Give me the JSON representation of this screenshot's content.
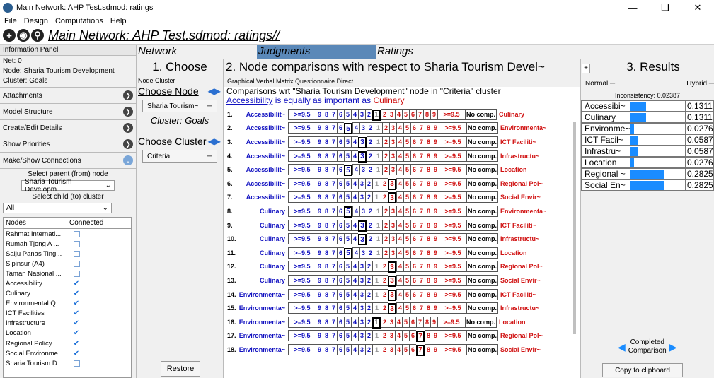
{
  "window": {
    "title": "Main Network: AHP Test.sdmod: ratings"
  },
  "menu": [
    "File",
    "Design",
    "Computations",
    "Help"
  ],
  "path": "Main Network: AHP Test.sdmod: ratings//",
  "info_panel": {
    "header": "Information Panel",
    "net": "Net: 0",
    "node": "Node: Sharia Tourism Development",
    "cluster": "Cluster: Goals",
    "rows": [
      "Attachments",
      "Model Structure",
      "Create/Edit Details",
      "Show Priorities",
      "Make/Show Connections"
    ],
    "select_parent_label": "Select parent (from) node",
    "parent_value": "Sharia Tourism Developm",
    "select_child_label": "Select child (to) cluster",
    "child_value": "All",
    "table_headers": [
      "Nodes",
      "Connected"
    ],
    "nodes": [
      {
        "name": "Rahmat Internati...",
        "connected": false
      },
      {
        "name": "Rumah Tjong A ...",
        "connected": false
      },
      {
        "name": "Salju Panas Ting...",
        "connected": false
      },
      {
        "name": "Sipinsur (A4)",
        "connected": false
      },
      {
        "name": "Taman Nasional ...",
        "connected": false
      },
      {
        "name": "Accessibility",
        "connected": true
      },
      {
        "name": "Culinary",
        "connected": true
      },
      {
        "name": "Environmental Q...",
        "connected": true
      },
      {
        "name": "ICT Facilities",
        "connected": true
      },
      {
        "name": "Infrastructure",
        "connected": true
      },
      {
        "name": "Location",
        "connected": true
      },
      {
        "name": "Regional Policy",
        "connected": true
      },
      {
        "name": "Social Environme...",
        "connected": true
      },
      {
        "name": "Sharia Tourism D...",
        "connected": false
      }
    ]
  },
  "tabs": [
    "Network",
    "Judgments",
    "Ratings"
  ],
  "choose": {
    "title": "1. Choose",
    "subtabs": "Node  Cluster",
    "choose_node": "Choose Node",
    "node_value": "Sharia Tourism~",
    "cluster_label": "Cluster: Goals",
    "choose_cluster": "Choose Cluster",
    "cluster_value": "Criteria",
    "restore": "Restore"
  },
  "comparisons": {
    "title": "2. Node comparisons with respect to Sharia Tourism Devel~",
    "plus": "+",
    "subtabs": "Graphical  Verbal  Matrix  Questionnaire  Direct",
    "wrt": "Comparisons wrt \"Sharia Tourism Development\" node in \"Criteria\" cluster",
    "statement_a": "Accessibility",
    "statement_mid": " is equally as important as ",
    "statement_b": "Culinary",
    "scale_left": [
      "9",
      "8",
      "7",
      "6",
      "5",
      "4",
      "3",
      "2"
    ],
    "scale_right": [
      "2",
      "3",
      "4",
      "5",
      "6",
      "7",
      "8",
      "9"
    ],
    "extreme": ">=9.5",
    "nocomp": "No comp.",
    "rows": [
      {
        "n": "1.",
        "a": "Accessibilit~",
        "b": "Culinary",
        "sel": "1"
      },
      {
        "n": "2.",
        "a": "Accessibilit~",
        "b": "Environmenta~",
        "sel": "L5"
      },
      {
        "n": "3.",
        "a": "Accessibilit~",
        "b": "ICT Faciliti~",
        "sel": "L3"
      },
      {
        "n": "4.",
        "a": "Accessibilit~",
        "b": "Infrastructu~",
        "sel": "L3"
      },
      {
        "n": "5.",
        "a": "Accessibilit~",
        "b": "Location",
        "sel": "L5"
      },
      {
        "n": "6.",
        "a": "Accessibilit~",
        "b": "Regional Pol~",
        "sel": "R3"
      },
      {
        "n": "7.",
        "a": "Accessibilit~",
        "b": "Social Envir~",
        "sel": "R3"
      },
      {
        "n": "8.",
        "a": "Culinary",
        "b": "Environmenta~",
        "sel": "L5"
      },
      {
        "n": "9.",
        "a": "Culinary",
        "b": "ICT Faciliti~",
        "sel": "L3"
      },
      {
        "n": "10.",
        "a": "Culinary",
        "b": "Infrastructu~",
        "sel": "L3"
      },
      {
        "n": "11.",
        "a": "Culinary",
        "b": "Location",
        "sel": "L5"
      },
      {
        "n": "12.",
        "a": "Culinary",
        "b": "Regional Pol~",
        "sel": "R3"
      },
      {
        "n": "13.",
        "a": "Culinary",
        "b": "Social Envir~",
        "sel": "R3"
      },
      {
        "n": "14.",
        "a": "Environmenta~",
        "b": "ICT Faciliti~",
        "sel": "R3"
      },
      {
        "n": "15.",
        "a": "Environmenta~",
        "b": "Infrastructu~",
        "sel": "R3"
      },
      {
        "n": "16.",
        "a": "Environmenta~",
        "b": "Location",
        "sel": "1"
      },
      {
        "n": "17.",
        "a": "Environmenta~",
        "b": "Regional Pol~",
        "sel": "R7"
      },
      {
        "n": "18.",
        "a": "Environmenta~",
        "b": "Social Envir~",
        "sel": "R7"
      }
    ]
  },
  "results": {
    "title": "3. Results",
    "mode_left": "Normal",
    "mode_right": "Hybrid",
    "inconsistency": "Inconsistency: 0.02387",
    "items": [
      {
        "name": "Accessibi~",
        "value": "0.1311",
        "frac": 0.1311
      },
      {
        "name": "Culinary",
        "value": "0.1311",
        "frac": 0.1311
      },
      {
        "name": "Environme~",
        "value": "0.0276",
        "frac": 0.0276
      },
      {
        "name": "ICT Facil~",
        "value": "0.0587",
        "frac": 0.0587
      },
      {
        "name": "Infrastru~",
        "value": "0.0587",
        "frac": 0.0587
      },
      {
        "name": "Location",
        "value": "0.0276",
        "frac": 0.0276
      },
      {
        "name": "Regional ~",
        "value": "0.2825",
        "frac": 0.2825
      },
      {
        "name": "Social En~",
        "value": "0.2825",
        "frac": 0.2825
      }
    ],
    "completed": "Completed",
    "comparison": "Comparison",
    "copy": "Copy to clipboard"
  }
}
